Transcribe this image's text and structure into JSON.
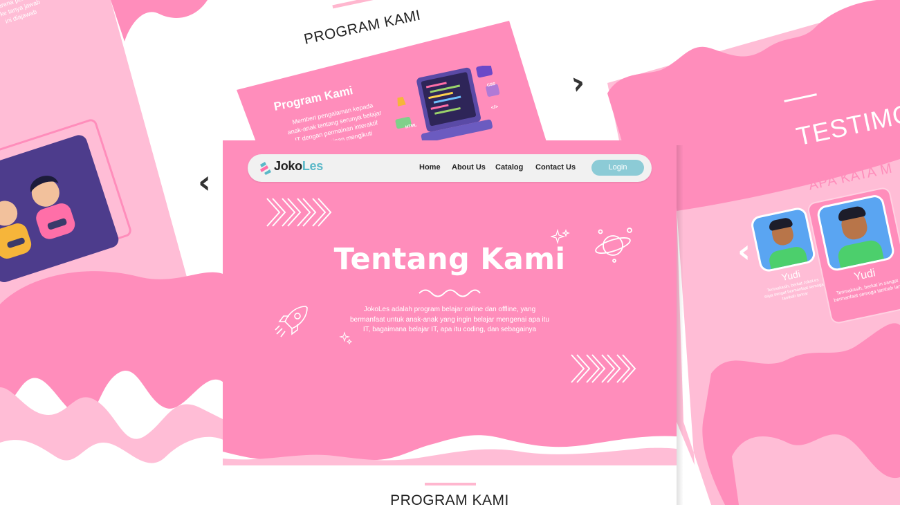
{
  "colors": {
    "pink": "#ff8dbb",
    "light_pink": "#ffbdd6",
    "teal": "#8ccbd6",
    "brand_teal": "#5ab8c8",
    "purple": "#4d3c8c"
  },
  "top_preview": {
    "heading": "PROGRAM KAMI",
    "card_title": "Program Kami",
    "card_lines": [
      "Memberi pengalaman kepada",
      "anak-anak tentang serunya belajar",
      "IT dengan permainan interaktif",
      "ayo permainan mengikuti"
    ],
    "code_tags": [
      "CSS",
      "HTML",
      "</>"
    ]
  },
  "left_preview": {
    "lines": [
      "karena per",
      "ke tanya jawab",
      "ini diajawab"
    ]
  },
  "right_preview": {
    "heading": "TESTIMO",
    "subheading": "APA KATA M",
    "card1": {
      "name": "Yudi",
      "text": "Terimakasih, berkat JokoLes saya sangat bermanfaat semoga tambah lancar"
    },
    "card2": {
      "name": "Yudi",
      "text": "Terimakasih, berkat in sangat bermanfaat semoga tambah lanc"
    }
  },
  "nav": {
    "brand_a": "Joko",
    "brand_b": "Les",
    "links": [
      "Home",
      "About Us",
      "Catalog",
      "Contact Us"
    ],
    "login": "Login"
  },
  "hero": {
    "title": "Tentang Kami",
    "description": "JokoLes adalah program belajar online dan offline, yang bermanfaat untuk anak-anak yang ingin belajar mengenai apa itu IT, bagaimana belajar IT, apa itu coding, dan sebagainya"
  },
  "arrows": {
    "left": "‹",
    "right": "›",
    "right_card_left": "‹"
  },
  "bottom": {
    "heading": "PROGRAM KAMI"
  }
}
